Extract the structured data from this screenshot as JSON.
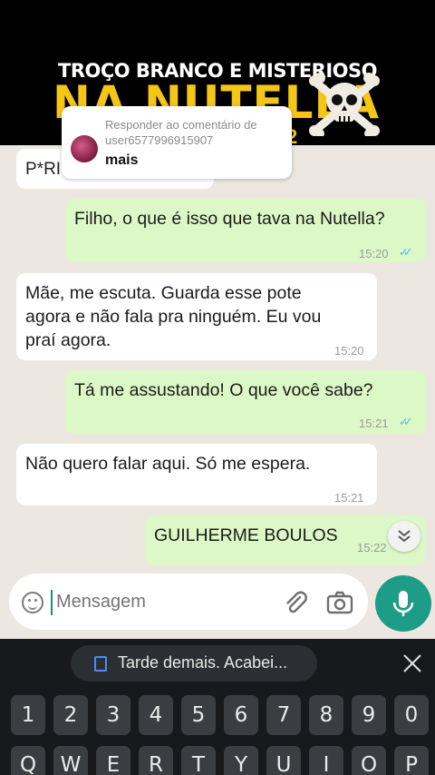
{
  "overlay": {
    "title": "TROÇO BRANCO E MISTERIOSO",
    "subtitle": "NA NUTELLA",
    "suffix": "2"
  },
  "reply_card": {
    "label": "Responder ao comentário de",
    "username": "user6577996915907",
    "text": "mais"
  },
  "partial_message": "P*RI",
  "messages": [
    {
      "direction": "out",
      "text": "Filho, o que é isso que tava na Nutella?",
      "time": "15:20",
      "read": true
    },
    {
      "direction": "in",
      "lines": [
        "Mãe, me escuta. Guarda esse pote",
        "agora e não fala pra ninguém. Eu vou",
        "praí agora."
      ],
      "time": "15:20"
    },
    {
      "direction": "out",
      "text": "Tá me assustando! O que você sabe?",
      "time": "15:21",
      "read": true
    },
    {
      "direction": "in",
      "text": "Não quero falar aqui. Só me espera.",
      "time": "15:21"
    },
    {
      "direction": "out",
      "text": "GUILHERME BOULOS",
      "time": "15:22"
    }
  ],
  "input": {
    "placeholder": "Mensagem"
  },
  "keyboard": {
    "suggestion": "Tarde demais. Acabei...",
    "number_row": [
      "1",
      "2",
      "3",
      "4",
      "5",
      "6",
      "7",
      "8",
      "9",
      "0"
    ],
    "letter_row": [
      "Q",
      "W",
      "E",
      "R",
      "T",
      "Y",
      "U",
      "I",
      "O",
      "P"
    ]
  },
  "colors": {
    "outgoing_bubble": "#dcf8c6",
    "incoming_bubble": "#ffffff",
    "chat_background": "#ece7e1",
    "accent": "#1d9c87",
    "read_ticks": "#4fb6ec",
    "overlay_yellow": "#f5c518"
  },
  "icons": [
    "skull-crossbones-icon",
    "emoji-icon",
    "paperclip-icon",
    "camera-icon",
    "microphone-icon",
    "chevron-double-down-icon",
    "clipboard-icon",
    "close-icon"
  ]
}
